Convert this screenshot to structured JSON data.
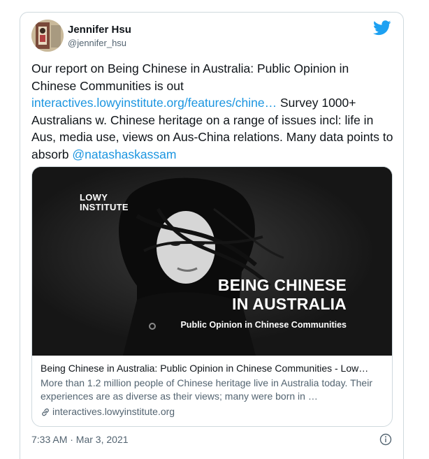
{
  "author": {
    "name": "Jennifer Hsu",
    "handle": "@jennifer_hsu",
    "avatar_icon": "profile-photo",
    "platform_icon": "twitter-bird-icon",
    "platform_color": "#1da1f2"
  },
  "tweet": {
    "text_part1": "Our report on Being Chinese in Australia: Public Opinion in Chinese Communities is out\n",
    "link_url": "interactives.lowyinstitute.org/features/chine…",
    "text_part2": " Survey 1000+ Australians w. Chinese heritage on a range of issues incl: life in Aus, media use, views on Aus-China relations. Many data points to absorb ",
    "mention": "@natashaskassam",
    "link_color": "#1b95e0"
  },
  "card": {
    "image": {
      "logo_line1": "LOWY",
      "logo_line2": "INSTITUTE",
      "headline_line1": "BEING CHINESE",
      "headline_line2": "IN AUSTRALIA",
      "subtitle": "Public Opinion in Chinese Communities"
    },
    "title": "Being Chinese in Australia: Public Opinion in Chinese Communities - Low…",
    "description": "More than 1.2 million people of Chinese heritage live in Australia today. Their experiences are as diverse as their views; many were born in …",
    "domain": "interactives.lowyinstitute.org",
    "domain_icon": "link-icon"
  },
  "footer": {
    "timestamp": "7:33 AM · Mar 3, 2021",
    "info_icon": "info-icon"
  }
}
